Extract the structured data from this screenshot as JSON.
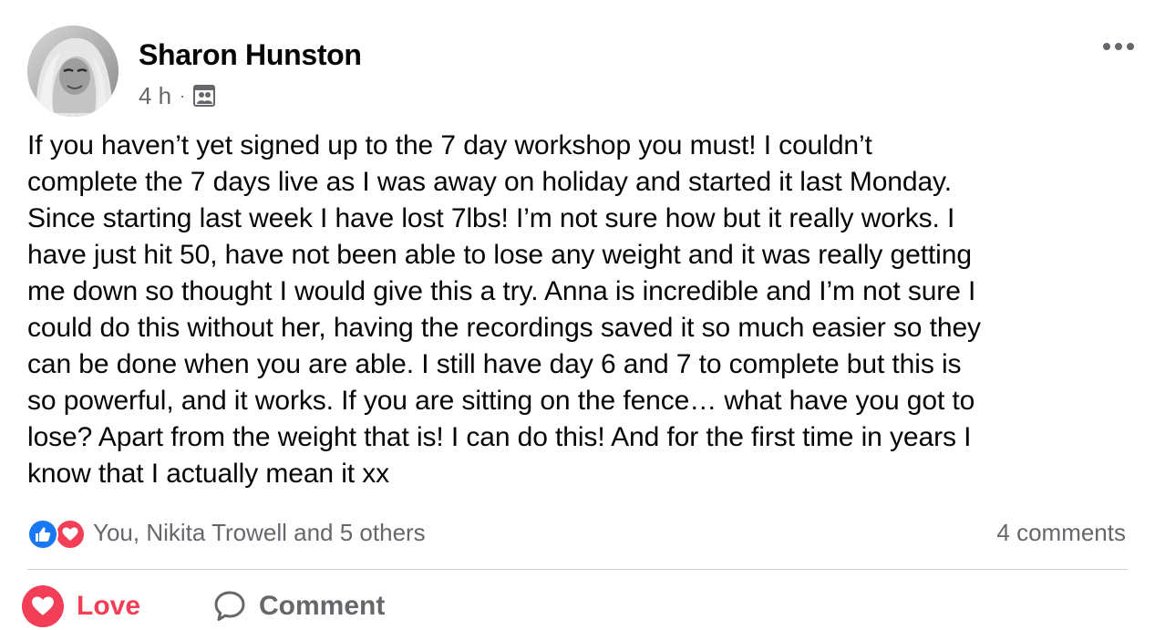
{
  "post": {
    "author": "Sharon Hunston",
    "time": "4 h",
    "separator": "·",
    "audience_icon": "group-icon",
    "text": "If you haven’t yet signed up to the 7 day workshop you must! I couldn’t\ncomplete the 7 days live as I was away on holiday and started it last Monday.\nSince starting last week I have lost 7lbs! I’m not sure how but it really works. I\nhave just hit 50, have not been able to lose any weight and it was really getting\nme down so thought I would give this a try. Anna is incredible and I’m not sure I\ncould do this without her, having the recordings saved it so much easier so they\ncan be done when you are able. I still have day 6 and 7 to complete but this is\nso powerful, and it works. If you are sitting on the fence… what have you got to\nlose? Apart from the weight that is! I can do this! And for the first time in years I\nknow that I actually mean it xx"
  },
  "reactions": {
    "icons": [
      "like-icon",
      "love-icon"
    ],
    "summary": "You, Nikita Trowell and 5 others"
  },
  "comments": {
    "count_label": "4 comments"
  },
  "actions": {
    "love_label": "Love",
    "comment_label": "Comment"
  },
  "colors": {
    "love": "#f33e58",
    "like": "#1877f2",
    "secondary_text": "#65676b",
    "primary_text": "#050505",
    "divider": "#ced0d4"
  }
}
